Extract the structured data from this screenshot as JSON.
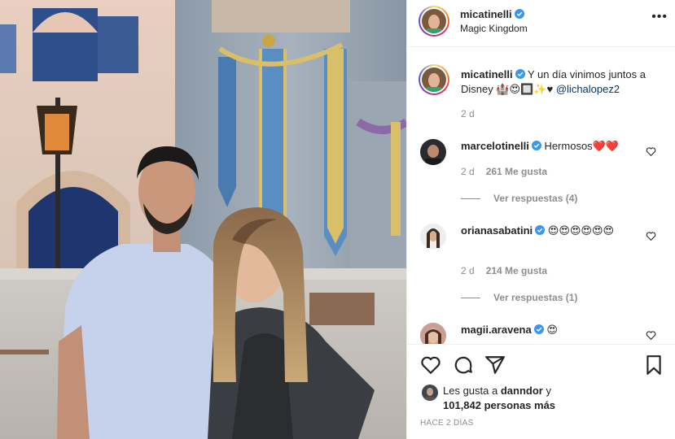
{
  "header": {
    "username": "micatinelli",
    "location": "Magic Kingdom",
    "more_label": "•••"
  },
  "caption": {
    "username": "micatinelli",
    "text": "Y un día vinimos juntos a Disney",
    "emojis": "🏰😍🔲✨♥",
    "mention": "@lichalopez2",
    "time": "2 d"
  },
  "comments": [
    {
      "username": "marcelotinelli",
      "text": "Hermosos",
      "emojis": "❤️❤️",
      "time": "2 d",
      "likes": "261 Me gusta",
      "replies": "Ver respuestas (4)"
    },
    {
      "username": "orianasabatini",
      "text": "",
      "emojis": "😍😍😍😍😍😍",
      "time": "2 d",
      "likes": "214 Me gusta",
      "replies": "Ver respuestas (1)"
    },
    {
      "username": "magii.aravena",
      "text": "",
      "emojis": "😍"
    }
  ],
  "likes": {
    "prefix": "Les gusta a",
    "user": "danndor",
    "conj": "y",
    "count": "101,842 personas más"
  },
  "posted": "HACE 2 DÍAS",
  "icons": {
    "verified": "verified-badge-icon",
    "more": "more-options-icon",
    "like": "heart-icon",
    "comment": "comment-icon",
    "share": "share-icon",
    "save": "bookmark-icon"
  },
  "colors": {
    "verified": "#3897f0",
    "link": "#00376b",
    "muted": "#8e8e8e",
    "heart_red": "#ed4956"
  }
}
